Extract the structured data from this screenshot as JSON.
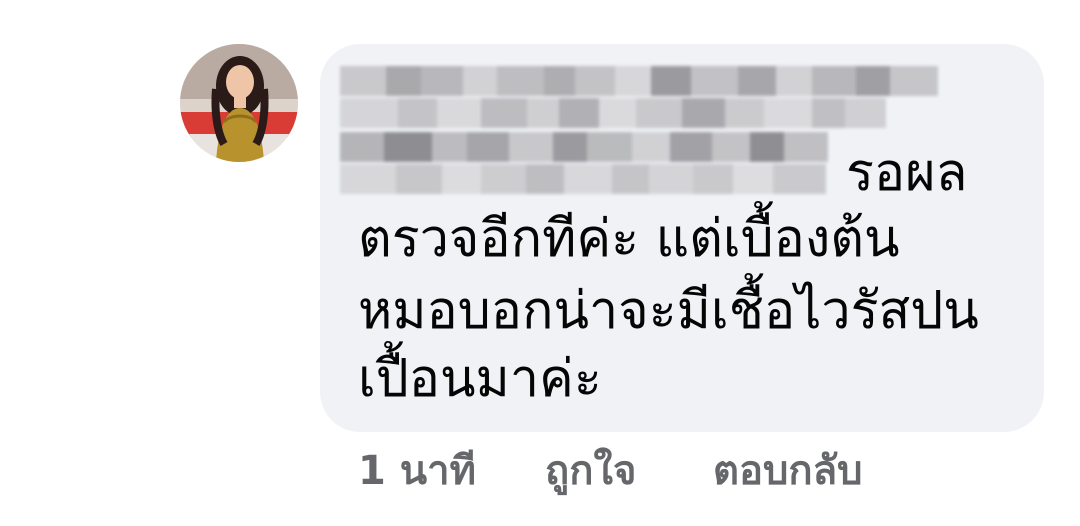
{
  "comment": {
    "text_line1_visible_tail": "รอผล",
    "text_line2": "ตรวจอีกทีค่ะ แต่เบื้องต้น",
    "text_line3": "หมอบอกน่าจะมีเชื้อไวรัสปน",
    "text_line4": "เปื้อนมาค่ะ"
  },
  "actions": {
    "timestamp": "1 นาที",
    "like_label": "ถูกใจ",
    "reply_label": "ตอบกลับ"
  },
  "colors": {
    "bubble_bg": "#f0f2f5",
    "text": "#050505",
    "action_text": "#65676b"
  }
}
